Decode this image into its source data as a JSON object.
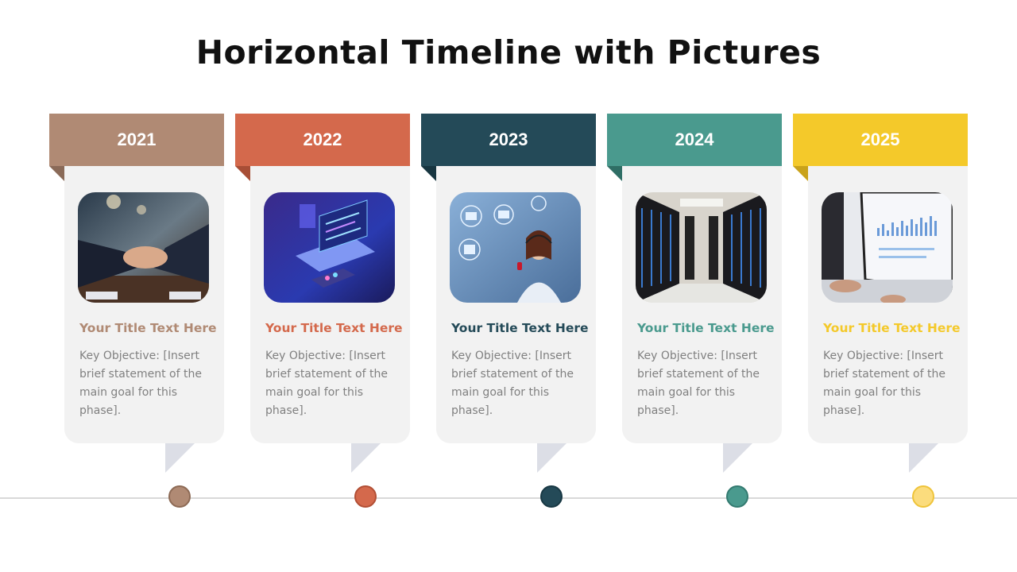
{
  "slide": {
    "title": "Horizontal Timeline with Pictures"
  },
  "phases": [
    {
      "year": "2021",
      "color": "#b08a74",
      "fold_color": "#8a6a58",
      "dot_fill": "#b08a74",
      "dot_border": "#8d6a55",
      "title": "Your Title Text Here",
      "text": "Key Objective: [Insert brief statement of the main goal for this phase].",
      "image": "business-handshake-photo"
    },
    {
      "year": "2022",
      "color": "#d4694c",
      "fold_color": "#a84e36",
      "dot_fill": "#d4694c",
      "dot_border": "#b24f35",
      "title": "Your Title Text Here",
      "text": "Key Objective: [Insert brief statement of the main goal for this phase].",
      "image": "isometric-laptop-code-photo"
    },
    {
      "year": "2023",
      "color": "#244a58",
      "fold_color": "#173540",
      "dot_fill": "#244a58",
      "dot_border": "#183844",
      "title": "Your Title Text Here",
      "text": "Key Objective: [Insert brief statement of the main goal for this phase].",
      "image": "customer-support-headset-photo"
    },
    {
      "year": "2024",
      "color": "#4a9a8e",
      "fold_color": "#2f6e65",
      "dot_fill": "#4a9a8e",
      "dot_border": "#337a70",
      "title": "Your Title Text Here",
      "text": "Key Objective: [Insert brief statement of the main goal for this phase].",
      "image": "server-room-photo"
    },
    {
      "year": "2025",
      "color": "#f4c92a",
      "fold_color": "#c9a21a",
      "dot_fill": "#fbdc7d",
      "dot_border": "#efc43a",
      "title": "Your Title Text Here",
      "text": "Key Objective: [Insert brief statement of the main goal for this phase].",
      "image": "analytics-monitor-photo"
    }
  ]
}
